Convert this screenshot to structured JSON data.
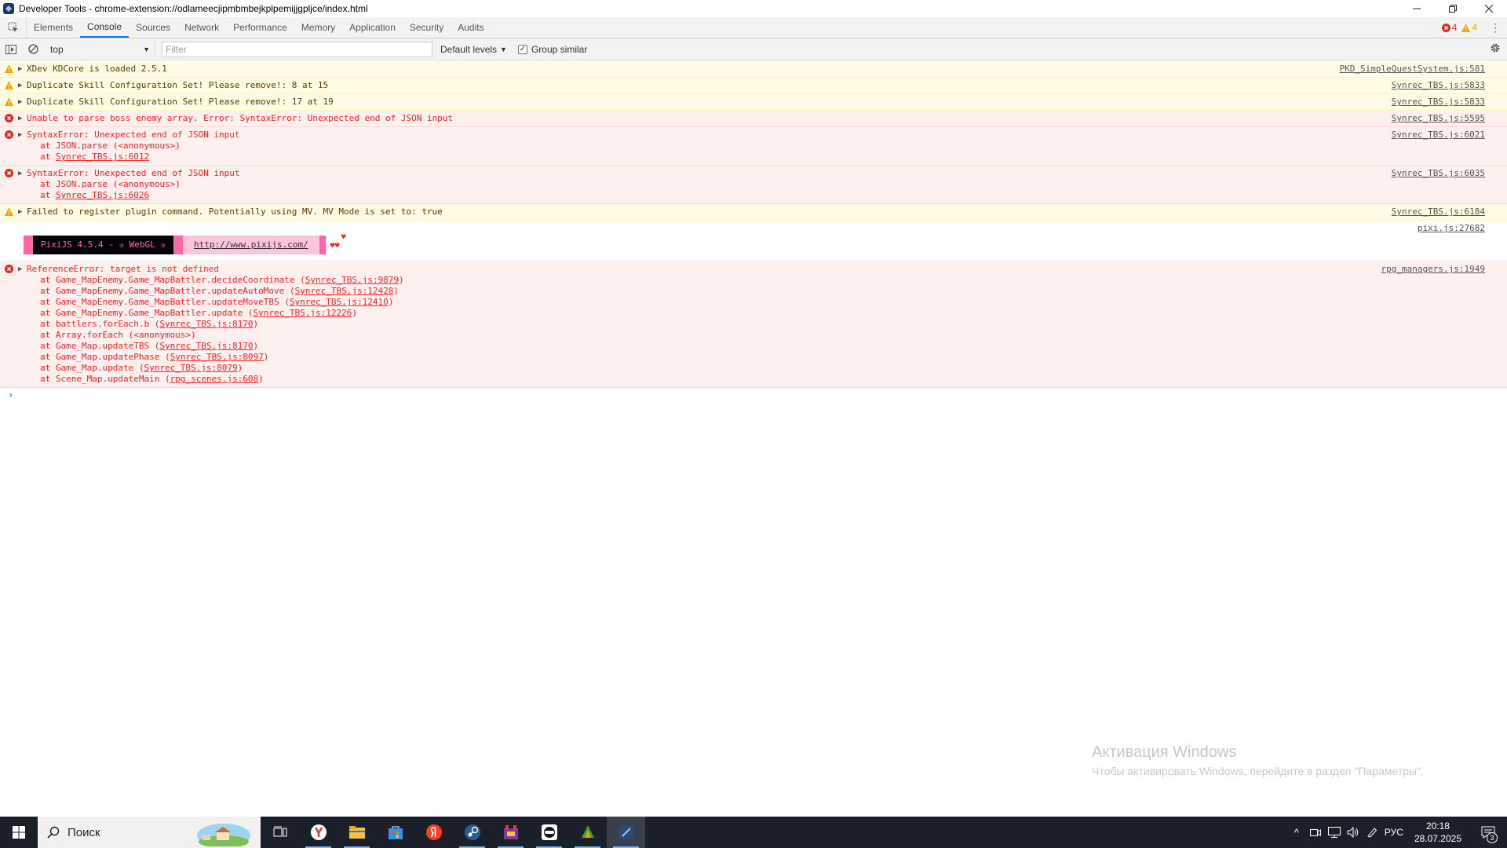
{
  "window": {
    "title": "Developer Tools - chrome-extension://odlameecjipmbmbejkplpemijjgpljce/index.html",
    "minimize_icon": "minimize-icon",
    "restore_icon": "restore-icon",
    "close_icon": "close-icon"
  },
  "tabs": [
    {
      "label": "Elements"
    },
    {
      "label": "Console",
      "active": true
    },
    {
      "label": "Sources"
    },
    {
      "label": "Network"
    },
    {
      "label": "Performance"
    },
    {
      "label": "Memory"
    },
    {
      "label": "Application"
    },
    {
      "label": "Security"
    },
    {
      "label": "Audits"
    }
  ],
  "counters": {
    "errors": "4",
    "warnings": "4"
  },
  "toolbar": {
    "context": "top",
    "filter_placeholder": "Filter",
    "levels": "Default levels",
    "group_similar": "Group similar",
    "group_similar_checked": true
  },
  "messages": [
    {
      "level": "warn",
      "text": "XDev KDCore is loaded 2.5.1",
      "source": "PKD_SimpleQuestSystem.js:581"
    },
    {
      "level": "warn",
      "text": "Duplicate Skill Configuration Set! Please remove!: 8 at 15",
      "source": "Synrec_TBS.js:5833"
    },
    {
      "level": "warn",
      "text": "Duplicate Skill Configuration Set! Please remove!: 17 at 19",
      "source": "Synrec_TBS.js:5833"
    },
    {
      "level": "error",
      "text": "Unable to parse boss enemy array. Error: SyntaxError: Unexpected end of JSON input",
      "source": "Synrec_TBS.js:5595"
    },
    {
      "level": "error",
      "text": "SyntaxError: Unexpected end of JSON input",
      "source": "Synrec_TBS.js:6021",
      "stack": [
        {
          "pre": "at JSON.parse (<anonymous>)",
          "link": ""
        },
        {
          "pre": "at ",
          "link": "Synrec_TBS.js:6012"
        }
      ]
    },
    {
      "level": "error",
      "text": "SyntaxError: Unexpected end of JSON input",
      "source": "Synrec_TBS.js:6035",
      "stack": [
        {
          "pre": "at JSON.parse (<anonymous>)",
          "link": ""
        },
        {
          "pre": "at ",
          "link": "Synrec_TBS.js:6026"
        }
      ]
    },
    {
      "level": "warn",
      "text": "Failed to register plugin command. Potentially using MV. MV Mode is set to: true",
      "source": "Synrec_TBS.js:6184"
    }
  ],
  "pixi": {
    "source": "pixi.js:27682",
    "banner": "PixiJS 4.5.4 - ✰ WebGL ✰",
    "url": "http://www.pixijs.com/",
    "hearts": "♥♥",
    "heart_top": "♥"
  },
  "ref_error": {
    "text": "ReferenceError: target is not defined",
    "source": "rpg_managers.js:1949",
    "stack": [
      {
        "pre": "at Game_MapEnemy.Game_MapBattler.decideCoordinate (",
        "link": "Synrec_TBS.js:9879",
        "post": ")"
      },
      {
        "pre": "at Game_MapEnemy.Game_MapBattler.updateAutoMove (",
        "link": "Synrec_TBS.js:12428",
        "post": ")"
      },
      {
        "pre": "at Game_MapEnemy.Game_MapBattler.updateMoveTBS (",
        "link": "Synrec_TBS.js:12410",
        "post": ")"
      },
      {
        "pre": "at Game_MapEnemy.Game_MapBattler.update (",
        "link": "Synrec_TBS.js:12226",
        "post": ")"
      },
      {
        "pre": "at battlers.forEach.b (",
        "link": "Synrec_TBS.js:8170",
        "post": ")"
      },
      {
        "pre": "at Array.forEach (<anonymous>)",
        "link": "",
        "post": ""
      },
      {
        "pre": "at Game_Map.updateTBS (",
        "link": "Synrec_TBS.js:8170",
        "post": ")"
      },
      {
        "pre": "at Game_Map.updatePhase (",
        "link": "Synrec_TBS.js:8097",
        "post": ")"
      },
      {
        "pre": "at Game_Map.update (",
        "link": "Synrec_TBS.js:8079",
        "post": ")"
      },
      {
        "pre": "at Scene_Map.updateMain (",
        "link": "rpg_scenes.js:608",
        "post": ")"
      }
    ]
  },
  "prompt": "›",
  "watermark": {
    "title": "Активация Windows",
    "subtitle": "Чтобы активировать Windows, перейдите в раздел \"Параметры\"."
  },
  "taskbar": {
    "search": "Поиск",
    "apps": [
      {
        "icon": "task-view-icon"
      },
      {
        "icon": "yandex-browser-icon",
        "running": true
      },
      {
        "icon": "file-explorer-icon",
        "running": true
      },
      {
        "icon": "store-icon"
      },
      {
        "icon": "yandex-icon"
      },
      {
        "icon": "steam-icon",
        "running": true
      },
      {
        "icon": "game-icon-1",
        "running": true
      },
      {
        "icon": "game-icon-2",
        "running": true
      },
      {
        "icon": "game-icon-3",
        "running": true
      },
      {
        "icon": "devtools-icon",
        "running": true,
        "active": true
      }
    ],
    "lang": "РУС",
    "time": "20:18",
    "date": "28.07.2025",
    "notifications": "3"
  },
  "colors": {
    "accent": "#1a73e8",
    "error": "#fe2222",
    "warn": "#e8a100",
    "pixi_pink": "#ff66a5"
  }
}
